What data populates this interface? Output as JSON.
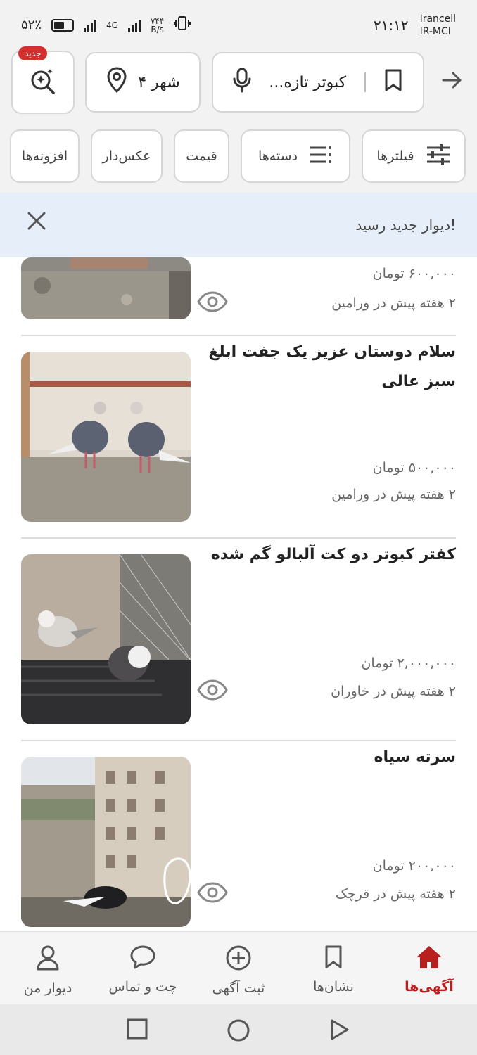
{
  "status_bar": {
    "battery": "۵۲٪",
    "network_type": "4G",
    "speed_value": "۷۴۴",
    "speed_unit": "B/s",
    "time": "۲۱:۱۲",
    "carrier_line1": "Irancell",
    "carrier_line2": "IR-MCI"
  },
  "search": {
    "new_badge": "جدید",
    "city_label": "۴ شهر",
    "query_text": "کبوتر تازه..."
  },
  "filters": {
    "filters_label": "فیلترها",
    "categories_label": "دسته‌ها",
    "price_label": "قیمت",
    "photo_label": "عکس‌دار",
    "addons_label": "افزونه‌ها"
  },
  "notice": {
    "text": "دیوار جدید رسید!"
  },
  "listings": [
    {
      "title": "",
      "price": "۶۰۰,۰۰۰ تومان",
      "meta": "۲ هفته پیش در ورامین",
      "seen": true
    },
    {
      "title": "سلام دوستان عزیز یک جفت ابلغ سبز عالی",
      "price": "۵۰۰,۰۰۰ تومان",
      "meta": "۲ هفته پیش در ورامین",
      "seen": false
    },
    {
      "title": "کفتر کبوتر دو کت آلبالو گم شده",
      "price": "۲,۰۰۰,۰۰۰ تومان",
      "meta": "۲ هفته پیش در خاوران",
      "seen": true
    },
    {
      "title": "سرته سیاه",
      "price": "۲۰۰,۰۰۰ تومان",
      "meta": "۲ هفته پیش در قرچک",
      "seen": true
    }
  ],
  "bottom_nav": {
    "ads": "آگهی‌ها",
    "bookmarks": "نشان‌ها",
    "post_ad": "ثبت آگهی",
    "chat": "چت و تماس",
    "my_divar": "دیوار من"
  },
  "colors": {
    "accent": "#b91f1f",
    "notice_bg": "#e6eef9"
  }
}
